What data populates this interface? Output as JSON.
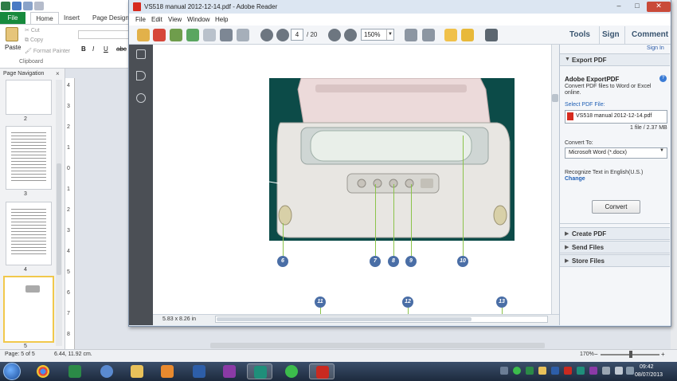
{
  "publisher": {
    "tabs": {
      "file": "File",
      "home": "Home",
      "insert": "Insert",
      "page_design": "Page Design"
    },
    "clipboard": {
      "paste": "Paste",
      "cut": "Cut",
      "copy": "Copy",
      "format_painter": "Format Painter",
      "group_label": "Clipboard"
    },
    "format": {
      "bold": "B",
      "italic": "I",
      "underline": "U",
      "strike": "abc"
    },
    "page_navigation": {
      "title": "Page Navigation",
      "close": "×",
      "thumbnails": [
        "2",
        "3",
        "4",
        "5"
      ]
    },
    "ruler_numbers": [
      "4",
      "3",
      "2",
      "1",
      "0",
      "1",
      "2",
      "3",
      "4",
      "5",
      "6",
      "7",
      "8"
    ],
    "status": {
      "page": "Page: 5 of 5",
      "position": "6.44, 11.92 cm.",
      "zoom": "170%"
    }
  },
  "reader": {
    "title": "VS518 manual 2012-12-14.pdf - Adobe Reader",
    "window_controls": {
      "minimize": "–",
      "maximize": "□",
      "close": "✕"
    },
    "menu": [
      "File",
      "Edit",
      "View",
      "Window",
      "Help"
    ],
    "toolbar": {
      "page_current": "4",
      "page_total": "/ 20",
      "zoom": "150%",
      "tools": "Tools",
      "sign": "Sign",
      "comment": "Comment"
    },
    "document": {
      "page_size": "5.83 x 8.26 in",
      "markers": [
        "6",
        "7",
        "8",
        "9",
        "10",
        "11",
        "12",
        "13"
      ]
    },
    "panel": {
      "sign_in": "Sign In",
      "export_pdf": "Export PDF",
      "export_title": "Adobe ExportPDF",
      "export_desc": "Convert PDF files to Word or Excel online.",
      "select_label": "Select PDF File:",
      "file_name": "VS518 manual 2012-12-14.pdf",
      "file_info": "1 file / 2.37 MB",
      "convert_to_label": "Convert To:",
      "convert_to_value": "Microsoft Word (*.docx)",
      "recognize": "Recognize Text in English(U.S.)",
      "change": "Change",
      "convert_button": "Convert",
      "create_pdf": "Create PDF",
      "send_files": "Send Files",
      "store_files": "Store Files"
    }
  },
  "taskbar": {
    "time": "09:42",
    "date": "08/07/2013"
  }
}
